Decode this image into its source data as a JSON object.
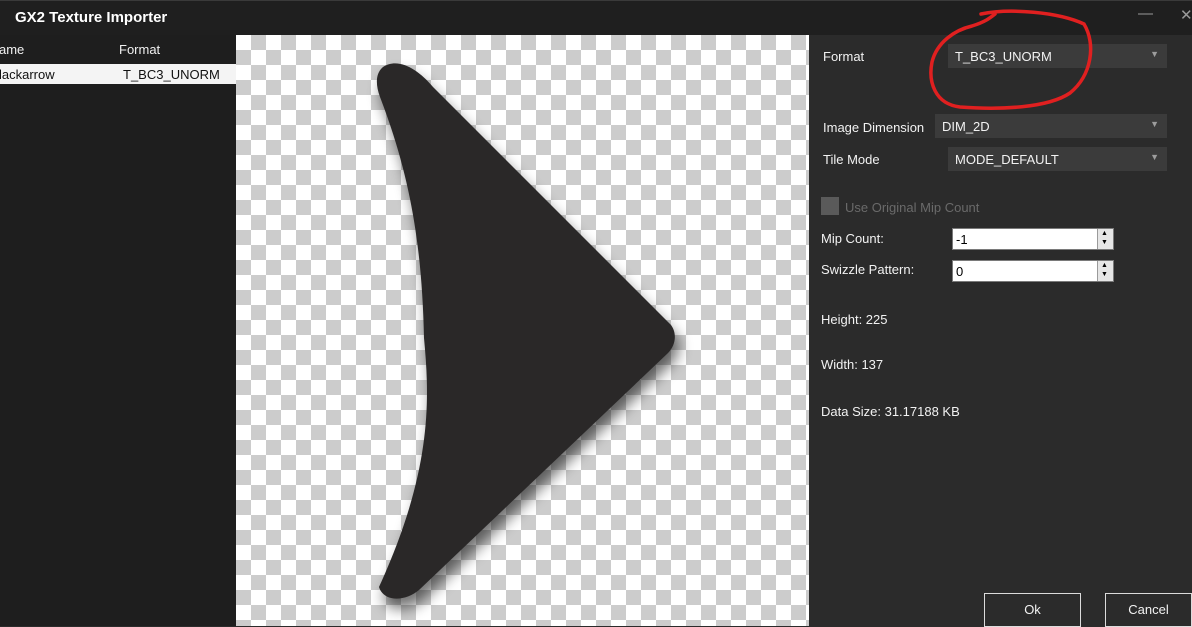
{
  "window": {
    "title": "GX2 Texture Importer"
  },
  "list": {
    "headers": {
      "name": "ame",
      "format": "Format"
    },
    "rows": [
      {
        "name": "lackarrow",
        "format": "T_BC3_UNORM"
      }
    ]
  },
  "settings": {
    "format_label": "Format",
    "format_value": "T_BC3_UNORM",
    "image_dimension_label": "Image Dimension",
    "image_dimension_value": "DIM_2D",
    "tile_mode_label": "Tile Mode",
    "tile_mode_value": "MODE_DEFAULT",
    "use_original_mip_label": "Use Original Mip Count",
    "mip_count_label": "Mip Count:",
    "mip_count_value": "-1",
    "swizzle_label": "Swizzle Pattern:",
    "swizzle_value": "0",
    "height_text": "Height: 225",
    "width_text": "Width: 137",
    "data_size_text": "Data Size: 31.17188 KB"
  },
  "buttons": {
    "ok": "Ok",
    "cancel": "Cancel"
  },
  "colors": {
    "background": "#2b2b2b",
    "title_bar": "#1f1f1f",
    "combo_background": "#3b3b3b",
    "annotation": "#e02020",
    "arrow_fill": "#2a2828"
  },
  "icons": {
    "minimize": "minimize-icon",
    "close": "close-icon",
    "dropdown": "chevron-down-icon"
  }
}
